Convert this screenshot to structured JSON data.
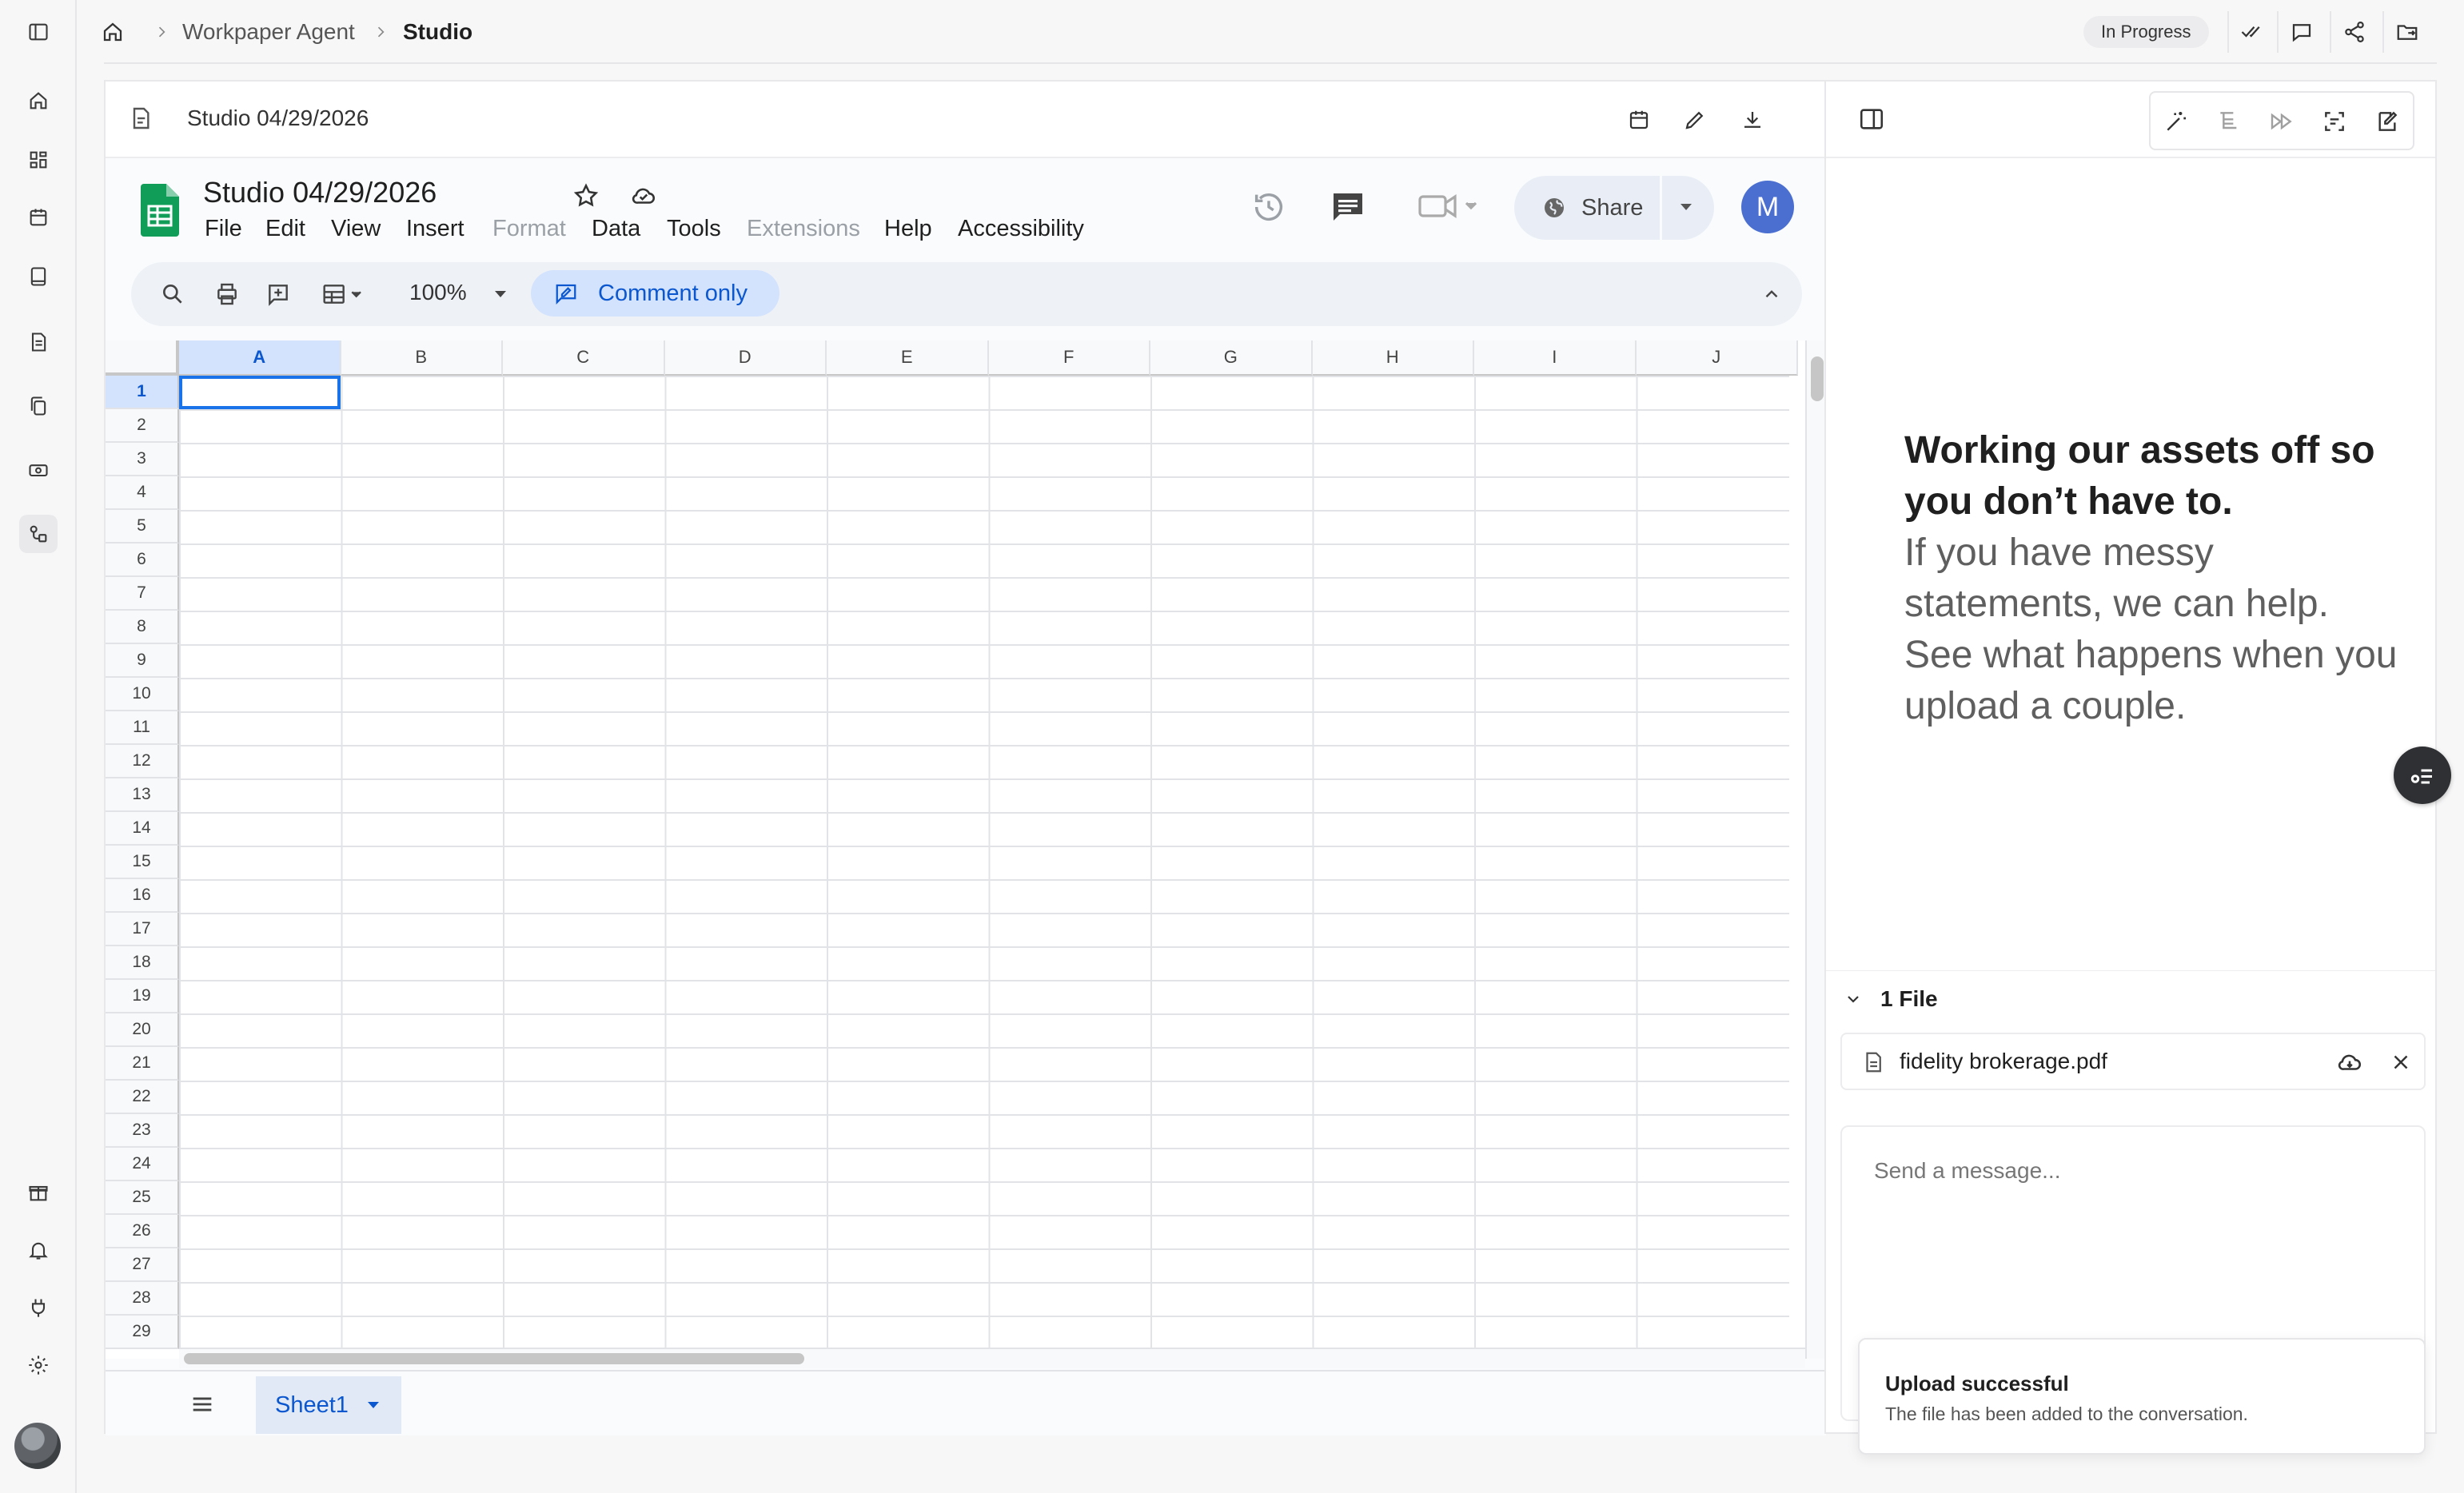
{
  "breadcrumb": {
    "parent": "Workpaper Agent",
    "current": "Studio"
  },
  "status_badge": "In Progress",
  "document": {
    "title": "Studio 04/29/2026"
  },
  "sheets": {
    "title": "Studio 04/29/2026",
    "menu": [
      "File",
      "Edit",
      "View",
      "Insert",
      "Format",
      "Data",
      "Tools",
      "Extensions",
      "Help",
      "Accessibility"
    ],
    "disabled_menu": [
      "Format",
      "Extensions"
    ],
    "share_label": "Share",
    "avatar_initial": "M",
    "zoom": "100%",
    "mode_label": "Comment only",
    "columns": [
      "A",
      "B",
      "C",
      "D",
      "E",
      "F",
      "G",
      "H",
      "I",
      "J"
    ],
    "rows": [
      "1",
      "2",
      "3",
      "4",
      "5",
      "6",
      "7",
      "8",
      "9",
      "10",
      "11",
      "12",
      "13",
      "14",
      "15",
      "16",
      "17",
      "18",
      "19",
      "20",
      "21",
      "22",
      "23",
      "24",
      "25",
      "26",
      "27",
      "28",
      "29"
    ],
    "active_cell": "A1",
    "sheet_tab": "Sheet1"
  },
  "panel": {
    "hero_bold": "Working our assets off so you don’t have to.",
    "hero_text": "If you have messy statements, we can help. See what happens when you upload a couple.",
    "files_heading": "1 File",
    "file_name": "fidelity brokerage.pdf",
    "message_placeholder": "Send a message..."
  },
  "toast": {
    "title": "Upload successful",
    "body": "The file has been added to the conversation."
  },
  "colors": {
    "accent": "#0b57d0",
    "sheets_green": "#0f9d58",
    "avatar": "#4a6fd1"
  }
}
